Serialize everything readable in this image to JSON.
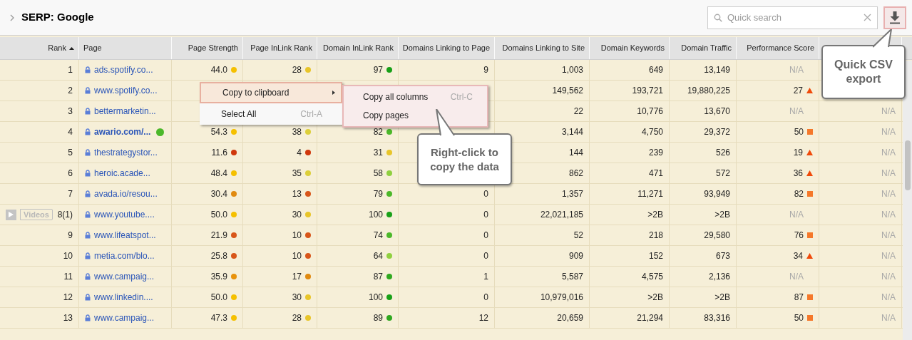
{
  "title": "SERP: Google",
  "search": {
    "placeholder": "Quick search"
  },
  "columns": [
    {
      "label": "Rank",
      "sorted": true
    },
    {
      "label": "Page",
      "sorted": false
    },
    {
      "label": "Page Strength",
      "sorted": false
    },
    {
      "label": "Page InLink Rank",
      "sorted": false
    },
    {
      "label": "Domain InLink Rank",
      "sorted": false
    },
    {
      "label": "Domains Linking to Page",
      "sorted": false
    },
    {
      "label": "Domains Linking to Site",
      "sorted": false
    },
    {
      "label": "Domain Keywords",
      "sorted": false
    },
    {
      "label": "Domain Traffic",
      "sorted": false
    },
    {
      "label": "Performance Score",
      "sorted": false
    }
  ],
  "rows": [
    {
      "rank": "1",
      "page": "ads.spotify.co...",
      "bold": false,
      "ps": {
        "text": "44.0",
        "color": "#f5c000"
      },
      "pir": {
        "text": "28",
        "color": "#e8c52a"
      },
      "dir": {
        "text": "97",
        "color": "#18a018"
      },
      "dlp": "9",
      "dls": "1,003",
      "dk": "649",
      "dt": "13,149",
      "perf": {
        "text": "N/A",
        "kind": "na"
      }
    },
    {
      "rank": "2",
      "page": "www.spotify.co...",
      "bold": false,
      "dls": "149,562",
      "dk": "193,721",
      "dt": "19,880,225",
      "perf": {
        "text": "27",
        "kind": "up"
      }
    },
    {
      "rank": "3",
      "page": "bettermarketin...",
      "bold": false,
      "dls": "22",
      "dk": "10,776",
      "dt": "13,670",
      "perf": {
        "text": "N/A",
        "kind": "na"
      },
      "last": "N/A"
    },
    {
      "rank": "4",
      "page": "awario.com/...",
      "bold": true,
      "indicator": {
        "color": "#4cb82a"
      },
      "ps": {
        "text": "54.3",
        "color": "#f5c000"
      },
      "pir": {
        "text": "38",
        "color": "#dccf3a"
      },
      "dir": {
        "text": "82",
        "color": "#4cb82a"
      },
      "dls": "3,144",
      "dk": "4,750",
      "dt": "29,372",
      "perf": {
        "text": "50",
        "kind": "square"
      },
      "last": "N/A"
    },
    {
      "rank": "5",
      "page": "thestrategystor...",
      "bold": false,
      "ps": {
        "text": "11.6",
        "color": "#d0380c"
      },
      "pir": {
        "text": "4",
        "color": "#d0380c"
      },
      "dir": {
        "text": "31",
        "color": "#e8c52a"
      },
      "dls": "144",
      "dk": "239",
      "dt": "526",
      "perf": {
        "text": "19",
        "kind": "up"
      },
      "last": "N/A"
    },
    {
      "rank": "6",
      "page": "heroic.acade...",
      "bold": false,
      "ps": {
        "text": "48.4",
        "color": "#f5c000"
      },
      "pir": {
        "text": "35",
        "color": "#dccf3a"
      },
      "dir": {
        "text": "58",
        "color": "#90d040"
      },
      "dls": "862",
      "dk": "471",
      "dt": "572",
      "perf": {
        "text": "36",
        "kind": "up"
      },
      "last": "N/A"
    },
    {
      "rank": "7",
      "page": "avada.io/resou...",
      "bold": false,
      "ps": {
        "text": "30.4",
        "color": "#e08a10"
      },
      "pir": {
        "text": "13",
        "color": "#d8561a"
      },
      "dir": {
        "text": "79",
        "color": "#4cb82a"
      },
      "dlp": "0",
      "dls": "1,357",
      "dk": "11,271",
      "dt": "93,949",
      "perf": {
        "text": "82",
        "kind": "square"
      },
      "last": "N/A"
    },
    {
      "rank": "8(1)",
      "tag": "Videos",
      "page": "www.youtube....",
      "bold": false,
      "ps": {
        "text": "50.0",
        "color": "#f5c000"
      },
      "pir": {
        "text": "30",
        "color": "#e8c52a"
      },
      "dir": {
        "text": "100",
        "color": "#18a018"
      },
      "dlp": "0",
      "dls": "22,021,185",
      "dk": ">2B",
      "dt": ">2B",
      "perf": {
        "text": "N/A",
        "kind": "na"
      },
      "last": "N/A"
    },
    {
      "rank": "9",
      "page": "www.lifeatspot...",
      "bold": false,
      "ps": {
        "text": "21.9",
        "color": "#d8561a"
      },
      "pir": {
        "text": "10",
        "color": "#d8561a"
      },
      "dir": {
        "text": "74",
        "color": "#4cb82a"
      },
      "dlp": "0",
      "dls": "52",
      "dk": "218",
      "dt": "29,580",
      "perf": {
        "text": "76",
        "kind": "square"
      },
      "last": "N/A"
    },
    {
      "rank": "10",
      "page": "metia.com/blo...",
      "bold": false,
      "ps": {
        "text": "25.8",
        "color": "#d8561a"
      },
      "pir": {
        "text": "10",
        "color": "#d8561a"
      },
      "dir": {
        "text": "64",
        "color": "#90d040"
      },
      "dlp": "0",
      "dls": "909",
      "dk": "152",
      "dt": "673",
      "perf": {
        "text": "34",
        "kind": "up"
      },
      "last": "N/A"
    },
    {
      "rank": "11",
      "page": "www.campaig...",
      "bold": false,
      "ps": {
        "text": "35.9",
        "color": "#e8920a"
      },
      "pir": {
        "text": "17",
        "color": "#e08a10"
      },
      "dir": {
        "text": "87",
        "color": "#30a820"
      },
      "dlp": "1",
      "dls": "5,587",
      "dk": "4,575",
      "dt": "2,136",
      "perf": {
        "text": "N/A",
        "kind": "na"
      },
      "last": "N/A"
    },
    {
      "rank": "12",
      "page": "www.linkedin....",
      "bold": false,
      "ps": {
        "text": "50.0",
        "color": "#f5c000"
      },
      "pir": {
        "text": "30",
        "color": "#e8c52a"
      },
      "dir": {
        "text": "100",
        "color": "#18a018"
      },
      "dlp": "0",
      "dls": "10,979,016",
      "dk": ">2B",
      "dt": ">2B",
      "perf": {
        "text": "87",
        "kind": "square"
      },
      "last": "N/A"
    },
    {
      "rank": "13",
      "page": "www.campaig...",
      "bold": false,
      "ps": {
        "text": "47.3",
        "color": "#f5c000"
      },
      "pir": {
        "text": "28",
        "color": "#e8c52a"
      },
      "dir": {
        "text": "89",
        "color": "#30a820"
      },
      "dlp": "12",
      "dls": "20,659",
      "dk": "21,294",
      "dt": "83,316",
      "perf": {
        "text": "50",
        "kind": "square"
      },
      "last": "N/A"
    }
  ],
  "context_menu": [
    {
      "label": "Copy to clipboard",
      "selected": true,
      "submenu": true
    },
    {
      "label": "Select All",
      "selected": false,
      "shortcut": "Ctrl-A"
    }
  ],
  "submenu": [
    {
      "label": "Copy all columns",
      "shortcut": "Ctrl-C"
    },
    {
      "label": "Copy pages"
    }
  ],
  "callouts": [
    {
      "text": "Right-click to copy the data"
    },
    {
      "text": "Quick CSV export"
    }
  ]
}
